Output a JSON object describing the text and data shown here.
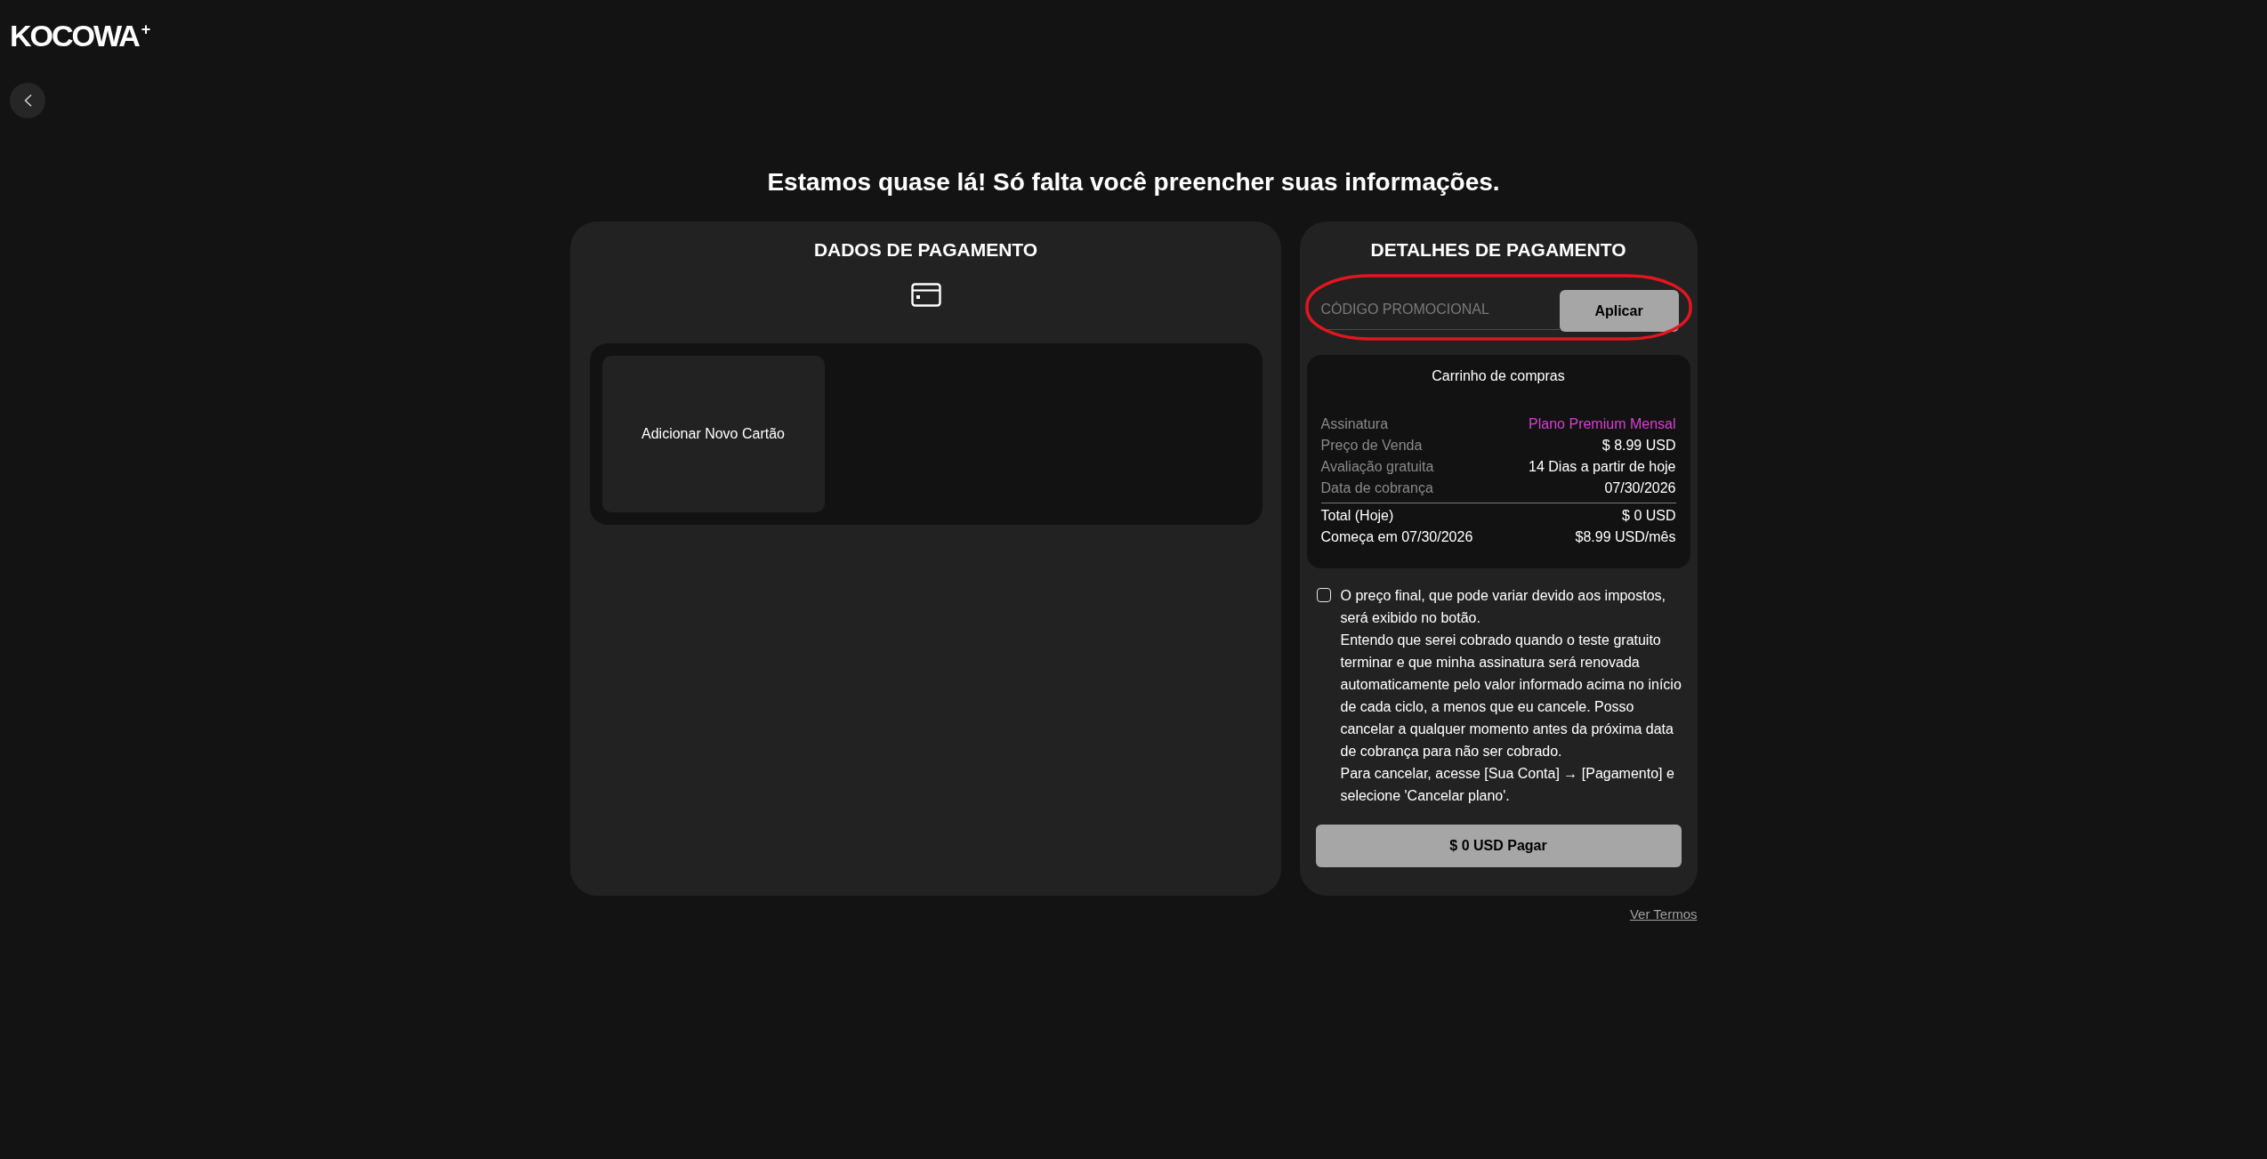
{
  "logo": {
    "text": "KOCOWA$^{+}$"
  },
  "heading": "Estamos quase lá! Só falta você preencher suas informações.",
  "payment_data": {
    "title": "DADOS DE PAGAMENTO",
    "cards": [
      {
        "kind": "add",
        "label": "Adicionar Novo Cartão"
      }
    ]
  },
  "payment_details": {
    "title": "DETALHES DE PAGAMENTO",
    "promo": {
      "placeholder": "CÓDIGO PROMOCIONAL",
      "button": "Aplicar",
      "highlighted": true
    },
    "cart": {
      "title": "Carrinho de compras",
      "items": [
        {
          "label": "Assinatura",
          "value": "Plano Premium Mensal",
          "color": "#d93fd3"
        },
        {
          "label": "Preço de Venda",
          "value": "$ 8.99 USD"
        },
        {
          "label": "Avaliação gratuita",
          "value": "14 Dias a partir de hoje"
        },
        {
          "label": "Data de cobrança",
          "value": "07/30/2026"
        }
      ],
      "summary": [
        {
          "label": "Total (Hoje)",
          "value": "$ 0 USD"
        },
        {
          "label": "Começa em 07/30/2026",
          "value": "$8.99 USD/mês"
        }
      ]
    },
    "consent": {
      "checked": false,
      "paragraphs": [
        "O preço final, que pode variar devido aos impostos, será exibido no botão.",
        "Entendo que serei cobrado quando o teste gratuito terminar e que minha assinatura será renovada automaticamente pelo valor informado acima no início de cada ciclo, a menos que eu cancele. Posso cancelar a qualquer momento antes da próxima data de cobrança para não ser cobrado.",
        "Para cancelar, acesse [Sua Conta] → [Pagamento] e selecione 'Cancelar plano'."
      ]
    },
    "pay_button": "$ 0 USD Pagar"
  },
  "terms_link": "Ver Termos"
}
